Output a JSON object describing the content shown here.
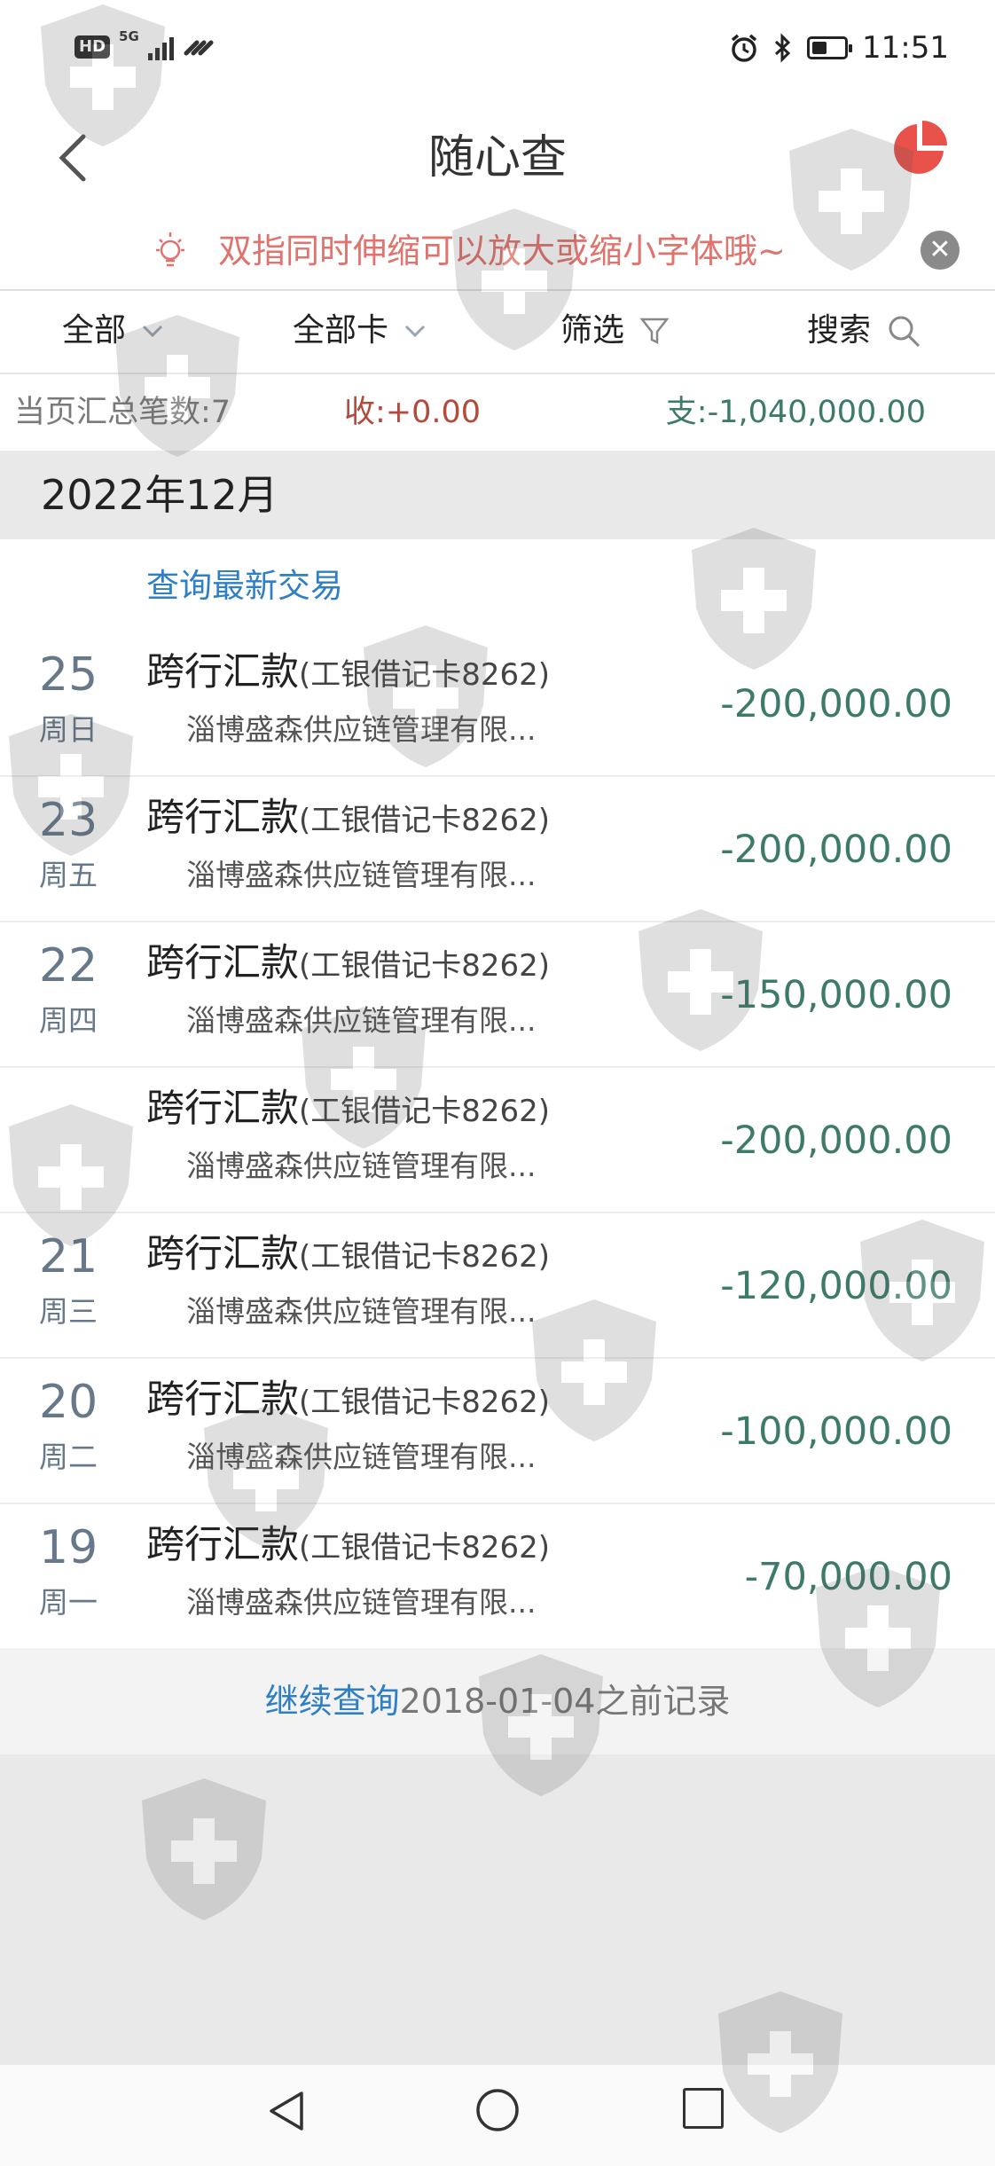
{
  "status_bar": {
    "hd": "HD",
    "network": "5G",
    "time": "11:51"
  },
  "header": {
    "title": "随心查"
  },
  "tip": {
    "text": "双指同时伸缩可以放大或缩小字体哦~"
  },
  "filters": {
    "all": "全部",
    "all_cards": "全部卡",
    "filter": "筛选",
    "search": "搜索"
  },
  "summary": {
    "count": "当页汇总笔数:7",
    "income": "收:+0.00",
    "expense": "支:-1,040,000.00"
  },
  "month": "2022年12月",
  "latest_link": "查询最新交易",
  "transactions": [
    {
      "day": "25",
      "weekday": "周日",
      "title": "跨行汇款",
      "card": "(工银借记卡8262)",
      "payee": "淄博盛森供应链管理有限...",
      "amount": "-200,000.00"
    },
    {
      "day": "23",
      "weekday": "周五",
      "title": "跨行汇款",
      "card": "(工银借记卡8262)",
      "payee": "淄博盛森供应链管理有限...",
      "amount": "-200,000.00"
    },
    {
      "day": "22",
      "weekday": "周四",
      "title": "跨行汇款",
      "card": "(工银借记卡8262)",
      "payee": "淄博盛森供应链管理有限...",
      "amount": "-150,000.00"
    },
    {
      "day": "",
      "weekday": "",
      "title": "跨行汇款",
      "card": "(工银借记卡8262)",
      "payee": "淄博盛森供应链管理有限...",
      "amount": "-200,000.00"
    },
    {
      "day": "21",
      "weekday": "周三",
      "title": "跨行汇款",
      "card": "(工银借记卡8262)",
      "payee": "淄博盛森供应链管理有限...",
      "amount": "-120,000.00"
    },
    {
      "day": "20",
      "weekday": "周二",
      "title": "跨行汇款",
      "card": "(工银借记卡8262)",
      "payee": "淄博盛森供应链管理有限...",
      "amount": "-100,000.00"
    },
    {
      "day": "19",
      "weekday": "周一",
      "title": "跨行汇款",
      "card": "(工银借记卡8262)",
      "payee": "淄博盛森供应链管理有限...",
      "amount": "-70,000.00"
    }
  ],
  "continue_query": {
    "link": "继续查询",
    "rest": "2018-01-04之前记录"
  },
  "colors": {
    "accent_link": "#2f7fc6",
    "tip_text": "#e0736d",
    "income": "#b24a3e",
    "expense": "#3d7a6a",
    "date": "#66788a",
    "pie_icon": "#e8524a"
  },
  "icons": [
    "back-arrow-icon",
    "pie-chart-icon",
    "lightbulb-icon",
    "close-icon",
    "chevron-down-icon",
    "filter-funnel-icon",
    "search-icon",
    "alarm-icon",
    "bluetooth-icon",
    "battery-icon"
  ]
}
